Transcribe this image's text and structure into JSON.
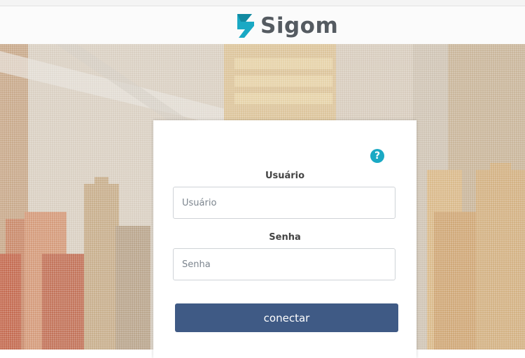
{
  "brand": {
    "name": "Sigom",
    "logo_color": "#1aa9c4",
    "text_color": "#555b61",
    "logo_icon": "sigom-logo-icon"
  },
  "login": {
    "help_icon": "help-icon",
    "help_text": "?",
    "help_color": "#1aa9c4",
    "username_label": "Usuário",
    "username_placeholder": "Usuário",
    "username_value": "",
    "password_label": "Senha",
    "password_placeholder": "Senha",
    "password_value": "",
    "submit_label": "conectar",
    "submit_color": "#3f5a85"
  },
  "background": {
    "description_icon": "city-skyline-image"
  }
}
